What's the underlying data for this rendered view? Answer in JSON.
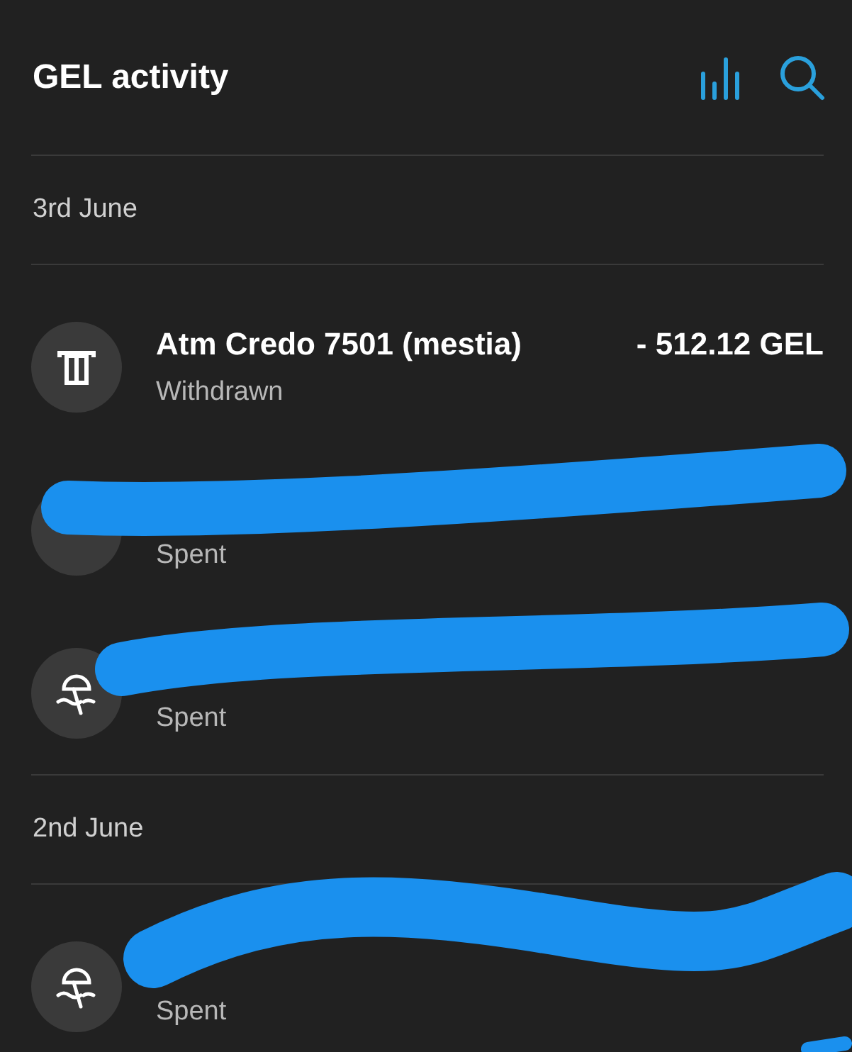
{
  "header": {
    "title": "GEL activity"
  },
  "groups": [
    {
      "date": "3rd June",
      "transactions": [
        {
          "kind": "atm",
          "name": "Atm Credo 7501 (mestia)",
          "amount": "- 512.12 GEL",
          "status": "Withdrawn"
        },
        {
          "kind": "hidden",
          "status": "Spent"
        },
        {
          "kind": "umbrella",
          "status": "Spent"
        }
      ]
    },
    {
      "date": "2nd June",
      "transactions": [
        {
          "kind": "umbrella",
          "status": "Spent"
        }
      ]
    }
  ]
}
